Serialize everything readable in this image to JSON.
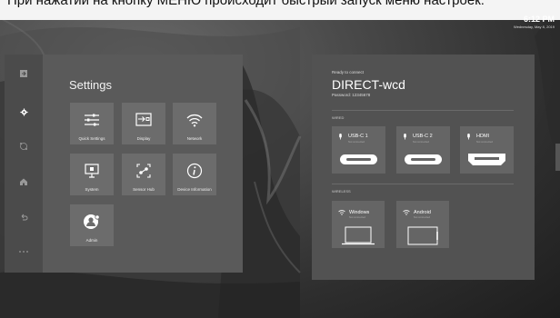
{
  "banner": {
    "text": "При нажатии на кнопку МЕНЮ происходит быстрый запуск меню настроек:"
  },
  "clock": {
    "time": "6:12 PM",
    "date": "Wednesday, May 8, 2019"
  },
  "rail": {
    "icons": [
      "input-source-icon",
      "gear-icon",
      "apps-icon",
      "home-icon",
      "back-icon",
      "more-icon"
    ]
  },
  "settings": {
    "title": "Settings",
    "tiles": [
      {
        "label": "Quick Settings",
        "icon": "sliders-icon"
      },
      {
        "label": "Display",
        "icon": "display-input-icon"
      },
      {
        "label": "Network",
        "icon": "wifi-icon"
      },
      {
        "label": "System",
        "icon": "monitor-icon"
      },
      {
        "label": "Sensor Hub",
        "icon": "sensor-hub-icon"
      },
      {
        "label": "Device Information",
        "icon": "info-icon"
      },
      {
        "label": "Admin",
        "icon": "admin-user-icon"
      }
    ]
  },
  "connect": {
    "ready": "Ready to connect",
    "ssid": "DIRECT-wcd",
    "password": "Password: 12345678",
    "wired_label": "WIRED",
    "wireless_label": "WIRELESS",
    "wired": [
      {
        "name": "USB-C 1",
        "sub": "Not connected"
      },
      {
        "name": "USB-C 2",
        "sub": "Not connected"
      },
      {
        "name": "HDMI",
        "sub": "Not connected"
      }
    ],
    "wireless": [
      {
        "name": "Windows",
        "sub": "Not connected"
      },
      {
        "name": "Android",
        "sub": "Not connected"
      }
    ]
  },
  "colors": {
    "panel": "#5a5a5a",
    "tile": "#6c6c6c",
    "connect_panel": "#525252"
  }
}
